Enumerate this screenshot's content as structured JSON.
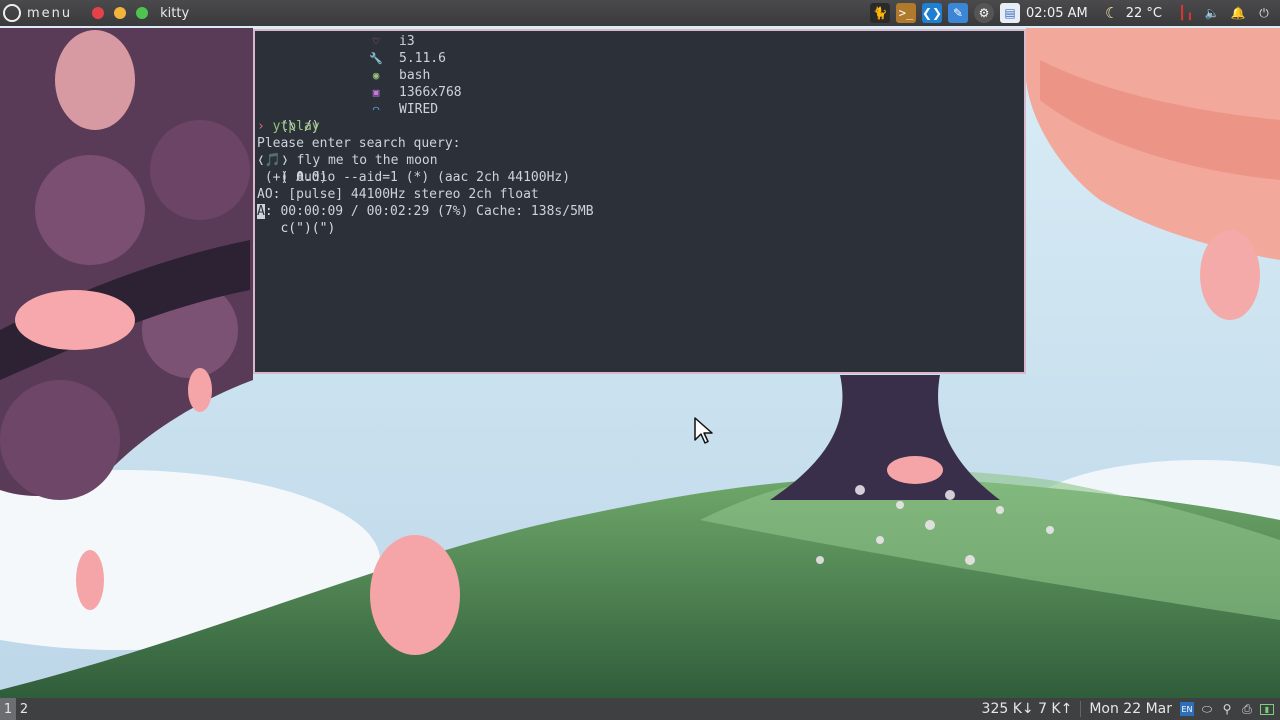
{
  "topbar": {
    "menu_label": "menu",
    "window_title": "kitty",
    "traffic_lights": [
      "#e6414a",
      "#f2b43a",
      "#4fc34f"
    ],
    "tray_icons": [
      "cat-icon",
      "terminal-icon",
      "vscode-icon",
      "pen-icon",
      "settings-icon",
      "calendar-icon"
    ],
    "time": "02:05 AM",
    "weather_icon": "moon-icon",
    "temperature": "22 °C",
    "tray_right_icons": [
      "equalizer-icon",
      "volume-icon",
      "bell-icon",
      "power-icon"
    ]
  },
  "terminal": {
    "ascii_art": [
      "(\\ /)",
      "( 0.0)",
      "c(\")(\")"
    ],
    "fetch": [
      {
        "icon": "heart-icon",
        "color": "#e06c75",
        "value": "i3"
      },
      {
        "icon": "wrench-icon",
        "color": "#e5c07b",
        "value": "5.11.6"
      },
      {
        "icon": "shell-icon",
        "color": "#98c379",
        "value": "bash"
      },
      {
        "icon": "image-icon",
        "color": "#c678dd",
        "value": "1366x768"
      },
      {
        "icon": "wifi-icon",
        "color": "#61afef",
        "value": "WIRED"
      }
    ],
    "prompt_symbol": "›",
    "command": "ytplay",
    "lines": [
      "Please enter search query:",
      "❬🎵❭ fly me to the moon",
      " (+) Audio --aid=1 (*) (aac 2ch 44100Hz)",
      "AO: [pulse] 44100Hz stereo 2ch float"
    ],
    "status_cursor_char": "A",
    "status_rest": ": 00:00:09 / 00:02:29 (7%) Cache: 138s/5MB"
  },
  "bottombar": {
    "workspaces": [
      "1",
      "2"
    ],
    "active_workspace": "1",
    "net_speed": "325 K↓ 7 K↑",
    "date": "Mon 22 Mar",
    "lang": "EN",
    "bb_icons": [
      "shield-icon",
      "location-icon",
      "printer-icon",
      "battery-icon"
    ]
  }
}
